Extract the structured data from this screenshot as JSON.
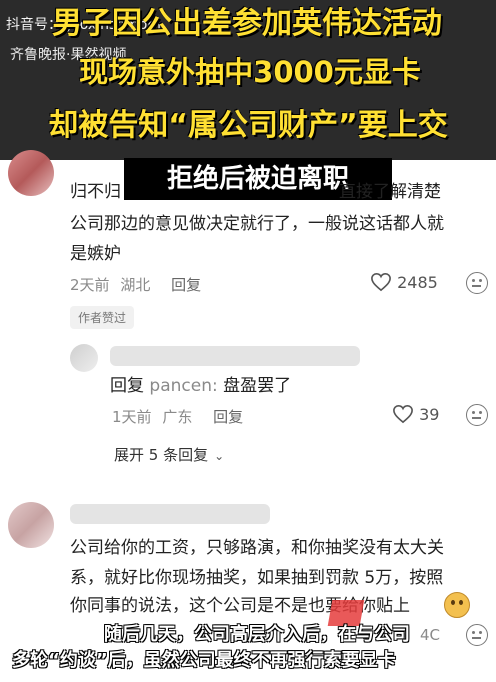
{
  "watermark": {
    "line1": "抖音号：guoxinshmom",
    "line2": "齐鲁晚报·果然视频"
  },
  "headline": {
    "line1": "男子因公出差参加英伟达活动",
    "line2": "现场意外抽中3000元显卡",
    "line3": "却被告知“属公司财产”要上交",
    "line4": "拒绝后被迫离职"
  },
  "comment1": {
    "text_line1_prefix": "归不归",
    "text_line1_suffix": "直接了解清楚",
    "text_line2": "公司那边的意见做决定就行了，一般说这话都人就",
    "text_line3": "是嫉妒",
    "time": "2天前",
    "location": "湖北",
    "reply_label": "回复",
    "likes": "2485",
    "author_liked": "作者赞过"
  },
  "reply1": {
    "prefix": "回复",
    "to_user": "pancen:",
    "text": "盘盈罢了",
    "time": "1天前",
    "location": "广东",
    "reply_label": "回复",
    "likes": "39"
  },
  "expand_replies": "展开 5 条回复",
  "comment2": {
    "line1": "公司给你的工资，只够路演，和你抽奖没有太大关",
    "line2": "系，就好比你现场抽奖，如果抽到罚款 5万，按照",
    "line3": "你同事的说法，这个公司是不是也要给你贴上",
    "partial_likes": "4C"
  },
  "subtitles": {
    "line1": "随后几天，公司高层介入后，在与公司",
    "line2": "多轮“约谈”后，虽然公司最终不再强行索要显卡"
  },
  "colors": {
    "headline_yellow": "#ffe033",
    "header_bg": "#2b2b2b",
    "meta_gray": "#8a8a8a"
  }
}
